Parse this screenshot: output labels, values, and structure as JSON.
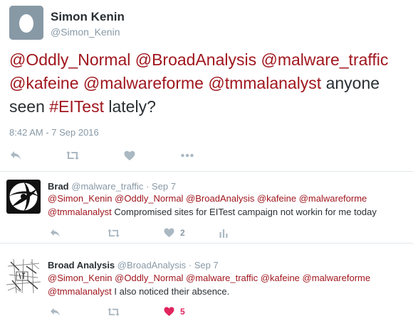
{
  "main_tweet": {
    "fullname": "Simon Kenin",
    "handle": "@Simon_Kenin",
    "text_parts": [
      {
        "text": "@Oddly_Normal",
        "kind": "mention"
      },
      {
        "text": " ",
        "kind": "plain"
      },
      {
        "text": "@BroadAnalysis",
        "kind": "mention"
      },
      {
        "text": " ",
        "kind": "plain"
      },
      {
        "text": "@malware_traffic",
        "kind": "mention"
      },
      {
        "text": " ",
        "kind": "plain"
      },
      {
        "text": "@kafeine",
        "kind": "mention"
      },
      {
        "text": " ",
        "kind": "plain"
      },
      {
        "text": "@malwareforme",
        "kind": "mention"
      },
      {
        "text": " ",
        "kind": "plain"
      },
      {
        "text": "@tmmalanalyst",
        "kind": "mention"
      },
      {
        "text": " anyone seen ",
        "kind": "plain"
      },
      {
        "text": "#EITest",
        "kind": "hashtag"
      },
      {
        "text": " lately?",
        "kind": "plain"
      }
    ],
    "timestamp": "8:42 AM - 7 Sep 2016",
    "actions": [
      "reply-icon",
      "retweet-icon",
      "heart-icon",
      "more-icon"
    ]
  },
  "replies": [
    {
      "fullname": "Brad",
      "handle": "@malware_traffic",
      "date": "Sep 7",
      "separator": "·",
      "avatar_icon": "gun-barrel-logo",
      "text_parts": [
        {
          "text": "@Simon_Kenin",
          "kind": "mention"
        },
        {
          "text": " ",
          "kind": "plain"
        },
        {
          "text": "@Oddly_Normal",
          "kind": "mention"
        },
        {
          "text": " ",
          "kind": "plain"
        },
        {
          "text": "@BroadAnalysis",
          "kind": "mention"
        },
        {
          "text": " ",
          "kind": "plain"
        },
        {
          "text": "@kafeine",
          "kind": "mention"
        },
        {
          "text": " ",
          "kind": "plain"
        },
        {
          "text": "@malwareforme",
          "kind": "mention"
        },
        {
          "text": " ",
          "kind": "plain"
        },
        {
          "text": "@tmmalanalyst",
          "kind": "mention"
        },
        {
          "text": " Compromised sites for EITest campaign not workin for me today",
          "kind": "plain"
        }
      ],
      "like_count": "2",
      "liked": false,
      "actions": [
        "reply-icon",
        "retweet-icon",
        "heart-icon",
        "analytics-icon"
      ]
    },
    {
      "fullname": "Broad Analysis",
      "handle": "@BroadAnalysis",
      "date": "Sep 7",
      "separator": "·",
      "avatar_icon": "map-avatar",
      "text_parts": [
        {
          "text": "@Simon_Kenin",
          "kind": "mention"
        },
        {
          "text": " ",
          "kind": "plain"
        },
        {
          "text": "@Oddly_Normal",
          "kind": "mention"
        },
        {
          "text": " ",
          "kind": "plain"
        },
        {
          "text": "@malware_traffic",
          "kind": "mention"
        },
        {
          "text": " ",
          "kind": "plain"
        },
        {
          "text": "@kafeine",
          "kind": "mention"
        },
        {
          "text": " ",
          "kind": "plain"
        },
        {
          "text": "@malwareforme",
          "kind": "mention"
        },
        {
          "text": " ",
          "kind": "plain"
        },
        {
          "text": "@tmmalanalyst",
          "kind": "mention"
        },
        {
          "text": " I also noticed their absence.",
          "kind": "plain"
        }
      ],
      "like_count": "5",
      "liked": true,
      "actions": [
        "reply-icon",
        "retweet-icon",
        "heart-icon"
      ]
    }
  ],
  "colors": {
    "link": "#a0161e",
    "text": "#292f33",
    "muted": "#8899a6",
    "icon": "#aab8c2",
    "liked": "#e0245e",
    "divider": "#e1e8ed"
  }
}
